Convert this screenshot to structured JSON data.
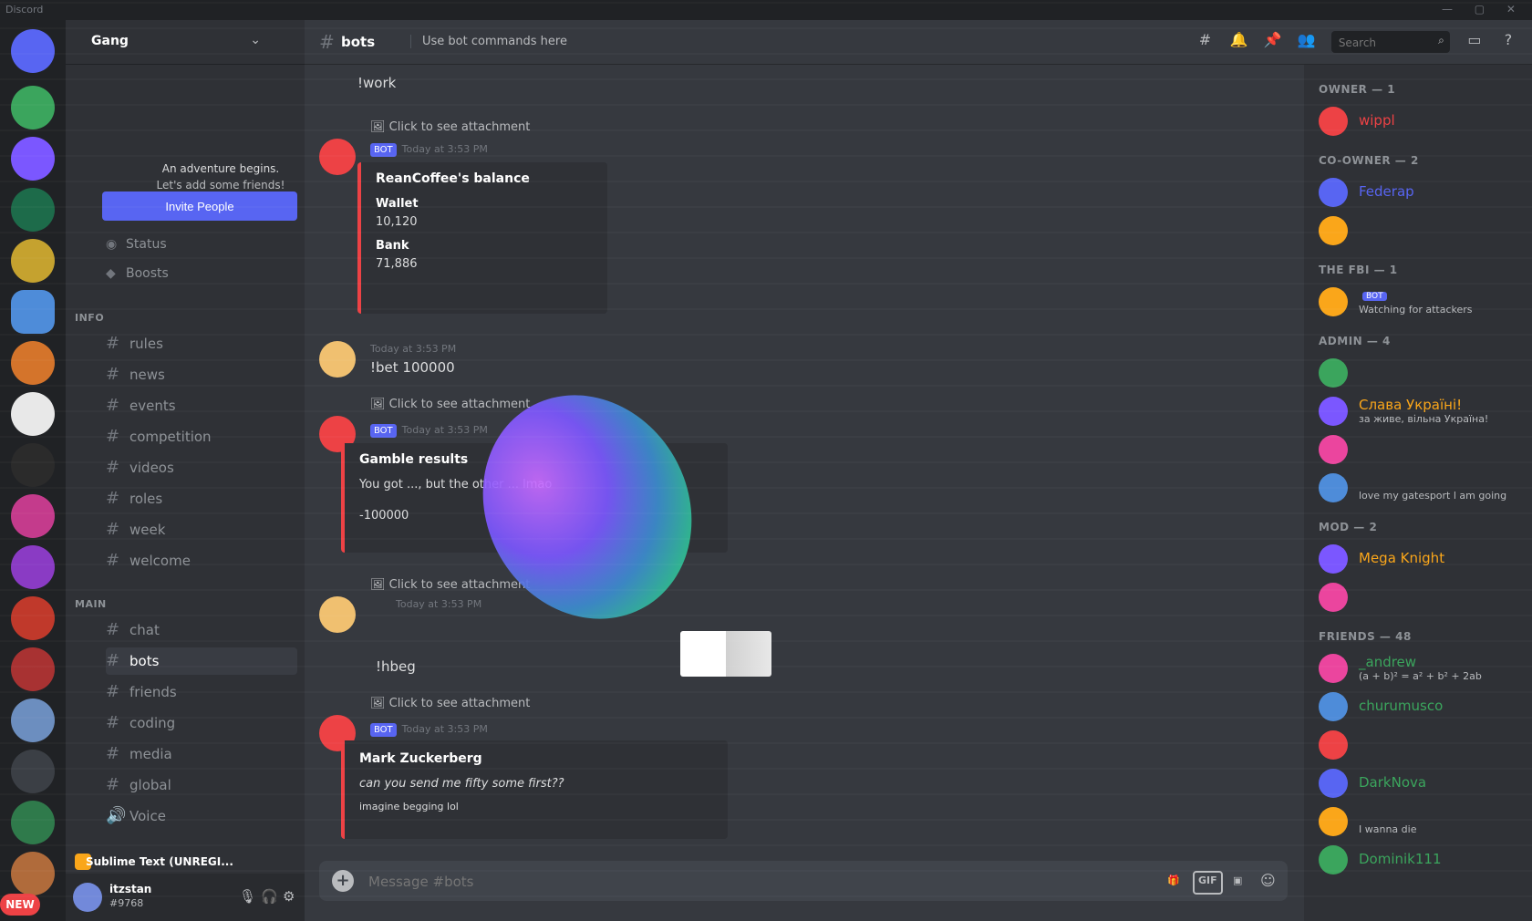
{
  "window": {
    "title": "Discord"
  },
  "guild": {
    "name": "Gang"
  },
  "sidebar": {
    "banner_line1": "An adventure begins.",
    "banner_line2": "Let's add some friends!",
    "invite_label": "Invite People",
    "status_row": "Status",
    "boosts_row": "Boosts",
    "categories": {
      "info": "INFO",
      "main": "MAIN"
    },
    "info_channels": [
      "rules",
      "news",
      "events",
      "competition",
      "videos",
      "roles",
      "week",
      "welcome"
    ],
    "main_channels": [
      "chat",
      "bots",
      "friends",
      "coding",
      "media",
      "global",
      "Voice"
    ],
    "active_channel": "bots"
  },
  "activity": {
    "text": "Sublime Text (UNREGI..."
  },
  "user": {
    "name": "itzstan",
    "tag": "#9768"
  },
  "rail": {
    "new_badge": "NEW"
  },
  "channel": {
    "name": "bots",
    "topic": "Use bot commands here"
  },
  "header": {
    "search_placeholder": "Search"
  },
  "messages": {
    "m0": {
      "text": "!work"
    },
    "m1": {
      "reply": "Click to see attachment",
      "bot_tag": "BOT",
      "time": "Today at 3:53 PM",
      "embed_title": "ReanCoffee's balance",
      "field1": "Wallet",
      "value1": "10,120",
      "field2": "Bank",
      "value2": "71,886"
    },
    "m2": {
      "time": "Today at 3:53 PM",
      "text": "!bet 100000"
    },
    "m3": {
      "reply": "Click to see attachment",
      "bot_tag": "BOT",
      "time": "Today at 3:53 PM",
      "embed_title": "Gamble results",
      "embed_sub": "You got ..., but the other ... lmao",
      "embed_val": "-100000"
    },
    "m4": {
      "reply": "Click to see attachment",
      "time": "Today at 3:53 PM",
      "text": "!hbeg"
    },
    "m5": {
      "reply": "Click to see attachment",
      "bot_tag": "BOT",
      "time": "Today at 3:53 PM",
      "embed_title": "Mark Zuckerberg",
      "embed_sub": "can you send me fifty some first??",
      "embed_foot": "imagine begging lol"
    }
  },
  "composer": {
    "placeholder": "Message #bots",
    "gif_label": "GIF"
  },
  "members": {
    "groups": [
      {
        "title": "OWNER — 1",
        "members": [
          {
            "name": "wippl",
            "color": "#ed4245"
          }
        ]
      },
      {
        "title": "CO-OWNER — 2",
        "members": [
          {
            "name": "Federap",
            "color": "#5865f2"
          },
          {
            "name": "",
            "color": "#5865f2"
          }
        ]
      },
      {
        "title": "THE FBI — 1",
        "members": [
          {
            "name": "",
            "badge": "BOT",
            "status": "Watching for attackers",
            "color": "#dcddde"
          }
        ]
      },
      {
        "title": "ADMIN — 4",
        "members": [
          {
            "name": "",
            "color": "#ed4245"
          },
          {
            "name": "Слава Україні!",
            "status": "за живе, вільна Україна!",
            "color": "#faa61a"
          },
          {
            "name": "",
            "color": "#ed4245"
          },
          {
            "name": "",
            "status": "love my gatesport l am going",
            "color": "#ed4245"
          }
        ]
      },
      {
        "title": "MOD — 2",
        "members": [
          {
            "name": "Mega Knight",
            "color": "#faa61a"
          },
          {
            "name": "",
            "color": "#faa61a"
          }
        ]
      },
      {
        "title": "FRIENDS — 48",
        "members": [
          {
            "name": "_andrew",
            "status": "(a + b)² = a² + b² + 2ab",
            "color": "#3ba55d"
          },
          {
            "name": "churumusco",
            "color": "#3ba55d"
          },
          {
            "name": "",
            "color": "#3ba55d"
          },
          {
            "name": "DarkNova",
            "color": "#3ba55d"
          },
          {
            "name": "",
            "status": "I wanna die",
            "color": "#3ba55d"
          },
          {
            "name": "Dominik111",
            "color": "#3ba55d"
          }
        ]
      }
    ]
  },
  "colors": {
    "blurple": "#5865f2",
    "red": "#ed4245",
    "green": "#3ba55d",
    "yellow": "#faa61a"
  }
}
